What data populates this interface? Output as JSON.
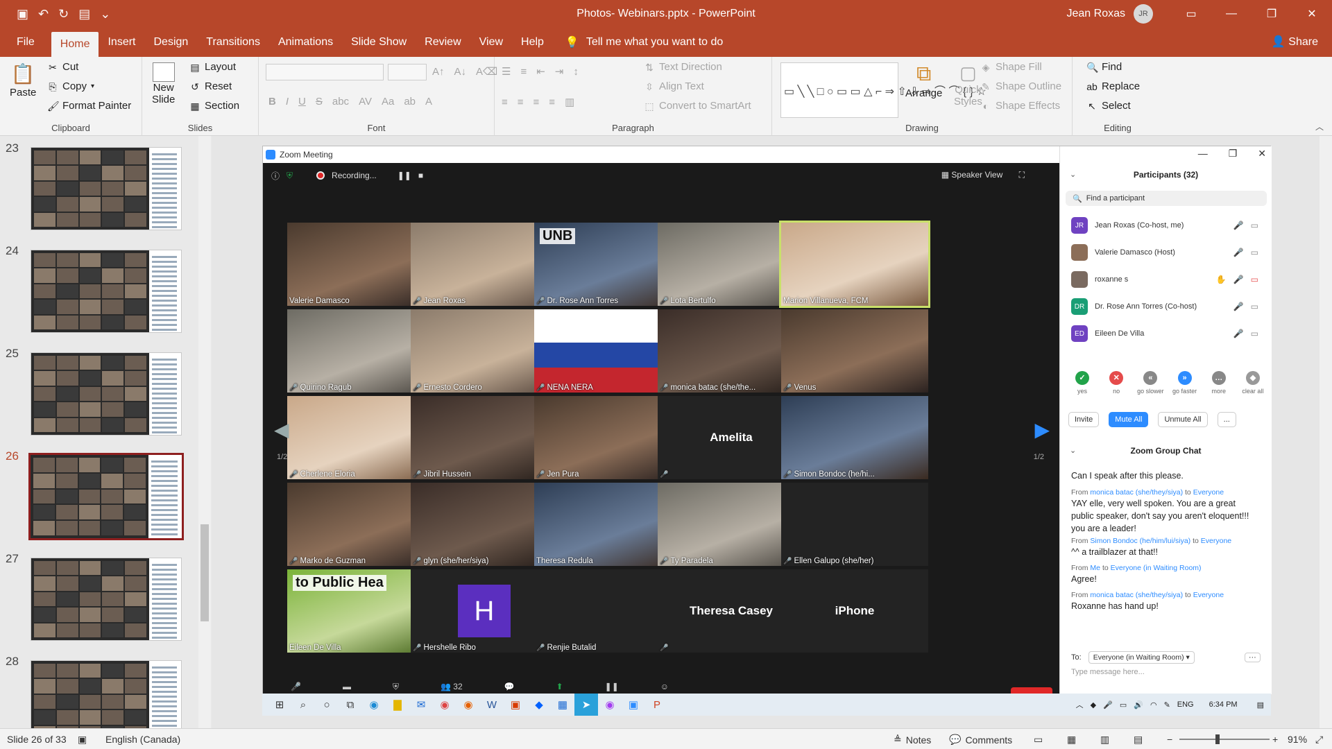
{
  "window": {
    "title": "Photos- Webinars.pptx  -  PowerPoint",
    "user_name": "Jean Roxas",
    "user_initials": "JR"
  },
  "menu": {
    "tabs": [
      "File",
      "Home",
      "Insert",
      "Design",
      "Transitions",
      "Animations",
      "Slide Show",
      "Review",
      "View",
      "Help"
    ],
    "tell_me": "Tell me what you want to do",
    "share": "Share"
  },
  "ribbon": {
    "clipboard": {
      "paste": "Paste",
      "cut": "Cut",
      "copy": "Copy",
      "format_painter": "Format Painter",
      "label": "Clipboard"
    },
    "slides": {
      "new_slide": "New",
      "new_slide2": "Slide",
      "layout": "Layout",
      "reset": "Reset",
      "section": "Section",
      "label": "Slides"
    },
    "font": {
      "label": "Font"
    },
    "paragraph": {
      "text_direction": "Text Direction",
      "align_text": "Align Text",
      "convert_smartart": "Convert to SmartArt",
      "label": "Paragraph"
    },
    "drawing": {
      "arrange": "Arrange",
      "quick": "Quick",
      "styles": "Styles",
      "shape_fill": "Shape Fill",
      "shape_outline": "Shape Outline",
      "shape_effects": "Shape Effects",
      "label": "Drawing"
    },
    "editing": {
      "find": "Find",
      "replace": "Replace",
      "select": "Select",
      "label": "Editing"
    }
  },
  "thumbnails": [
    {
      "num": "23",
      "active": false
    },
    {
      "num": "24",
      "active": false
    },
    {
      "num": "25",
      "active": false
    },
    {
      "num": "26",
      "active": true
    },
    {
      "num": "27",
      "active": false
    },
    {
      "num": "28",
      "active": false
    }
  ],
  "zoom": {
    "window_title": "Zoom Meeting",
    "recording": "Recording...",
    "speaker_view": "Speaker View",
    "page_left": "1/2",
    "page_right": "1/2",
    "participants_count": "32",
    "tiles": [
      {
        "name": "Valerie Damasco",
        "muted": false,
        "style": "ph-a"
      },
      {
        "name": "Jean Roxas",
        "muted": true,
        "style": "ph-b"
      },
      {
        "name": "Dr. Rose Ann Torres",
        "muted": true,
        "style": "ph-c",
        "overlay": "UNB"
      },
      {
        "name": "Lota Bertulfo",
        "muted": true,
        "style": "ph-d"
      },
      {
        "name": "Marion Villanueva, FCM",
        "muted": false,
        "style": "ph-e",
        "highlight": true
      },
      {
        "name": "Quirino Ragub",
        "muted": true,
        "style": "ph-d"
      },
      {
        "name": "Ernesto Cordero",
        "muted": true,
        "style": "ph-b"
      },
      {
        "name": "NENA NERA",
        "muted": true,
        "style": "ph-flag"
      },
      {
        "name": "monica batac (she/the...",
        "muted": true,
        "style": "ph-f"
      },
      {
        "name": "Venus",
        "muted": true,
        "style": "ph-a"
      },
      {
        "name": "Cherlene Eloria",
        "muted": true,
        "style": "ph-e"
      },
      {
        "name": "Jibril Hussein",
        "muted": true,
        "style": "ph-f"
      },
      {
        "name": "Jen Pura",
        "muted": true,
        "style": "ph-a"
      },
      {
        "name": "",
        "muted": true,
        "style": "text",
        "big": "Amelita"
      },
      {
        "name": "Simon Bondoc (he/hi...",
        "muted": true,
        "style": "ph-c"
      },
      {
        "name": "Marko de Guzman",
        "muted": true,
        "style": "ph-a"
      },
      {
        "name": "glyn (she/her/siya)",
        "muted": true,
        "style": "ph-f"
      },
      {
        "name": "Theresa Redula",
        "muted": false,
        "style": "ph-c"
      },
      {
        "name": "Ty Paradela",
        "muted": true,
        "style": "ph-d"
      },
      {
        "name": "Ellen Galupo (she/her)",
        "muted": true,
        "style": "text"
      },
      {
        "name": "Eileen De Villa",
        "muted": false,
        "style": "ph-green",
        "overlay": "to Public Hea"
      },
      {
        "name": "Hershelle Ribo",
        "muted": true,
        "style": "text",
        "letter": "H"
      },
      {
        "name": "Renjie Butalid",
        "muted": true,
        "style": "text"
      },
      {
        "name": "",
        "muted": true,
        "style": "text",
        "big": "Theresa Casey"
      },
      {
        "name": "",
        "muted": false,
        "style": "text",
        "big": "iPhone"
      }
    ]
  },
  "participants": {
    "header": "Participants (32)",
    "find_placeholder": "Find a participant",
    "list": [
      {
        "initials": "JR",
        "name": "Jean Roxas (Co-host, me)",
        "color": "#6f42c1"
      },
      {
        "initials": "",
        "name": "Valerie Damasco (Host)",
        "color": "#8c6e58"
      },
      {
        "initials": "",
        "name": "roxanne s",
        "color": "#7a6a60"
      },
      {
        "initials": "DR",
        "name": "Dr. Rose Ann Torres (Co-host)",
        "color": "#1a9e75"
      },
      {
        "initials": "ED",
        "name": "Eileen De Villa",
        "color": "#6f42c1"
      }
    ],
    "reactions": [
      {
        "label": "yes",
        "symbol": "✓",
        "color": "#22a34a"
      },
      {
        "label": "no",
        "symbol": "✕",
        "color": "#e54b4b"
      },
      {
        "label": "go slower",
        "symbol": "«",
        "color": "#888"
      },
      {
        "label": "go faster",
        "symbol": "»",
        "color": "#2d8cff"
      },
      {
        "label": "more",
        "symbol": "…",
        "color": "#888"
      },
      {
        "label": "clear all",
        "symbol": "◆",
        "color": "#999"
      }
    ],
    "buttons": {
      "invite": "Invite",
      "mute_all": "Mute All",
      "unmute_all": "Unmute All",
      "more": "..."
    }
  },
  "chat": {
    "header": "Zoom Group Chat",
    "messages": [
      {
        "from": "",
        "to": "",
        "text": "Can I speak after this please."
      },
      {
        "from": "monica batac (she/they/siya)",
        "to": "Everyone",
        "text": "YAY elle, very well spoken. You are a great public speaker, don't say you aren't eloquent!!! you are a leader!"
      },
      {
        "from": "Simon Bondoc (he/him/lui/siya)",
        "to": "Everyone",
        "text": "^^ a trailblazer at that!!"
      },
      {
        "from": "Me",
        "to": "Everyone (in Waiting Room)",
        "text": "Agree!"
      },
      {
        "from": "monica batac (she/they/siya)",
        "to": "Everyone",
        "text": "Roxanne has hand up!"
      }
    ],
    "from_word": "From",
    "to_word": "to",
    "to_label": "To:",
    "recipient": "Everyone (in Waiting Room)",
    "input_placeholder": "Type message here..."
  },
  "taskbar": {
    "lang": "ENG",
    "time": "6:34 PM"
  },
  "status": {
    "slide": "Slide 26 of 33",
    "language": "English (Canada)",
    "notes": "Notes",
    "comments": "Comments",
    "zoom_level": "91%"
  }
}
